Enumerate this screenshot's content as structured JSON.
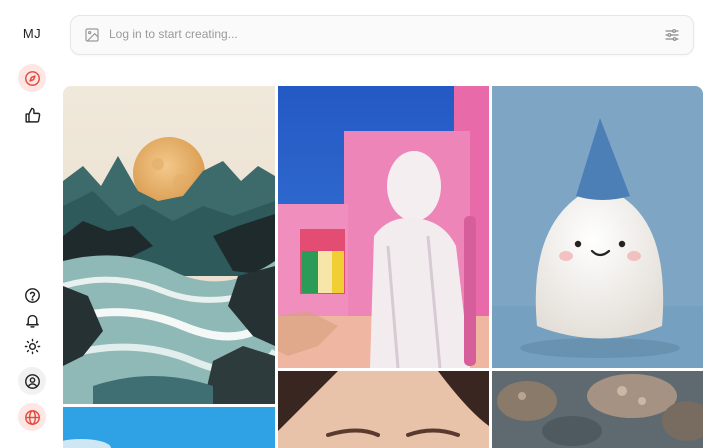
{
  "app": {
    "logo_text": "MJ",
    "accent_color": "#e4493b"
  },
  "search": {
    "placeholder": "Log in to start creating..."
  },
  "sidebar": {
    "top_items": [
      {
        "name": "explore",
        "icon": "compass-icon",
        "active": true
      },
      {
        "name": "likes",
        "icon": "thumbs-up-icon",
        "active": false
      }
    ],
    "bottom_items": [
      {
        "name": "help",
        "icon": "question-circle-icon"
      },
      {
        "name": "notifications",
        "icon": "bell-icon"
      },
      {
        "name": "theme",
        "icon": "sun-icon"
      },
      {
        "name": "account",
        "icon": "user-circle-icon"
      },
      {
        "name": "language",
        "icon": "globe-icon"
      }
    ]
  },
  "gallery": {
    "images": [
      {
        "subject": "full moon over rocky mountains and crashing sea waves"
      },
      {
        "subject": "hooded white figure against pink wall under blue sky"
      },
      {
        "subject": "felt white ghost with blue party hat"
      },
      {
        "subject": "blue sky with cloud"
      },
      {
        "subject": "close-up of a woman's face"
      },
      {
        "subject": "underwater coral reef"
      }
    ]
  }
}
